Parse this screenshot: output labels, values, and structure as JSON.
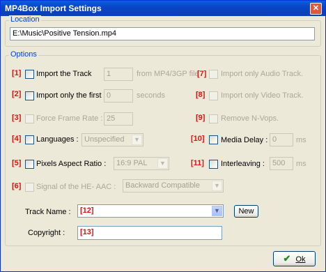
{
  "window": {
    "title": "MP4Box Import Settings",
    "close_glyph": "✕"
  },
  "location": {
    "group_label": "Location",
    "path": "E:\\Music\\Positive Tension.mp4"
  },
  "options": {
    "group_label": "Options",
    "import_track": {
      "num": "[1]",
      "label": "Import the Track",
      "value": "1",
      "suffix": "from MP4/3GP file"
    },
    "import_first": {
      "num": "[2]",
      "label": "Import only the first",
      "value": "0",
      "suffix": "seconds"
    },
    "force_frame_rate": {
      "num": "[3]",
      "label": "Force Frame Rate :",
      "value": "25"
    },
    "languages": {
      "num": "[4]",
      "label": "Languages :",
      "selected": "Unspecified"
    },
    "pixel_aspect": {
      "num": "[5]",
      "label": "Pixels Aspect Ratio :",
      "selected": "16:9  PAL"
    },
    "he_aac": {
      "num": "[6]",
      "label": "Signal of the HE- AAC :",
      "selected": "Backward Compatible"
    },
    "only_audio": {
      "num": "[7]",
      "label": "Import only Audio Track."
    },
    "only_video": {
      "num": "[8]",
      "label": "Import only Video Track."
    },
    "remove_nvops": {
      "num": "[9]",
      "label": "Remove N-Vops."
    },
    "media_delay": {
      "num": "[10]",
      "label": "Media Delay :",
      "value": "0",
      "unit": "ms"
    },
    "interleaving": {
      "num": "[11]",
      "label": "Interleaving  :",
      "value": "500",
      "unit": "ms"
    },
    "track_name": {
      "label": "Track Name :",
      "value": "[12]",
      "new_button": "New"
    },
    "copyright": {
      "label": "Copyright :",
      "value": "[13]"
    }
  },
  "ok_button": {
    "label": "Ok",
    "check_glyph": "✔"
  },
  "colors": {
    "accent": "#0046d5",
    "number_red": "#e0120e",
    "title_blue": "#0a5fe0"
  }
}
